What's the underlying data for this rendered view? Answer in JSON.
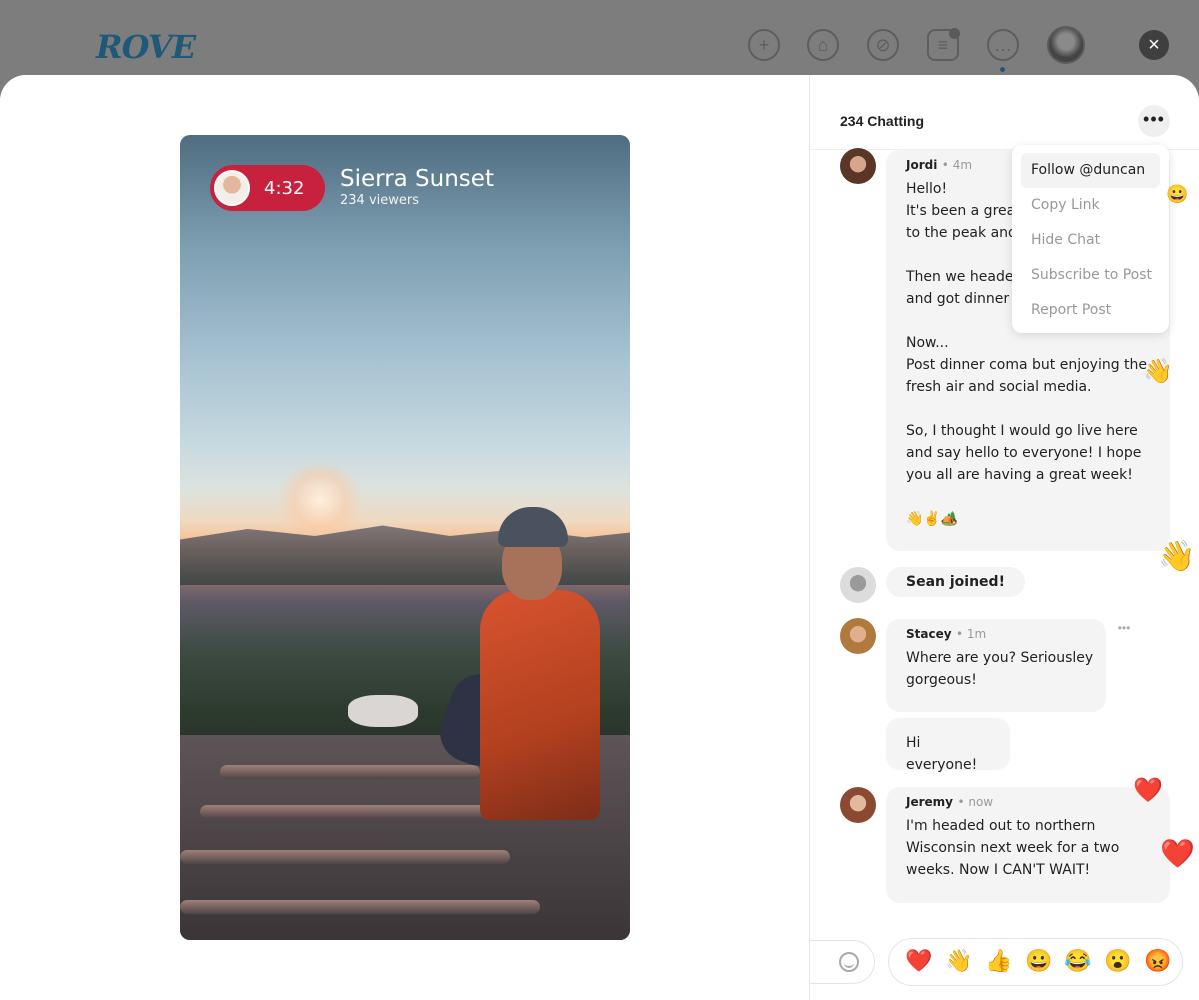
{
  "app": {
    "logo": "ROVE",
    "close_label": "×"
  },
  "nav": [
    {
      "icon": "plus-icon",
      "glyph": "+"
    },
    {
      "icon": "home-icon",
      "glyph": "⌂"
    },
    {
      "icon": "explore-icon",
      "glyph": "⊘"
    },
    {
      "icon": "notes-icon",
      "glyph": "≡"
    },
    {
      "icon": "chat-icon",
      "glyph": "…"
    }
  ],
  "stream": {
    "timer": "4:32",
    "title": "Sierra Sunset",
    "viewers": "234 viewers"
  },
  "chat": {
    "header": "234 Chatting",
    "more_label": "•••",
    "menu": [
      "Follow @duncan",
      "Copy Link",
      "Hide Chat",
      "Subscribe to Post",
      "Report Post"
    ],
    "messages": {
      "jordi": {
        "name": "Jordi",
        "time": "• 4m",
        "lines": [
          "Hello!",
          "It's been a great",
          "to the peak and",
          "",
          "Then we headed",
          "and got dinner",
          "",
          "Now...",
          "Post dinner coma but enjoying the",
          "fresh air and social media.",
          "",
          "So, I thought I would go live here",
          "and say hello to everyone! I hope",
          "you all are having a great week!",
          "",
          "👋✌️🏕️"
        ]
      },
      "sean": {
        "text": "Sean joined!"
      },
      "stacey": {
        "name": "Stacey",
        "time": "• 1m",
        "lines": [
          "Where are you? Seriousley",
          "gorgeous!"
        ],
        "followup": "Hi everyone!"
      },
      "jeremy": {
        "name": "Jeremy",
        "time": "• now",
        "lines": [
          "I'm headed out to northern",
          "Wisconsin next week for a two",
          "weeks. Now I CAN'T WAIT!"
        ]
      }
    },
    "floating": [
      "😀",
      "👋",
      "👋",
      "❤️",
      "❤️"
    ],
    "reactions": [
      "❤️",
      "👋",
      "👍",
      "😀",
      "😂",
      "😮",
      "😡"
    ]
  }
}
